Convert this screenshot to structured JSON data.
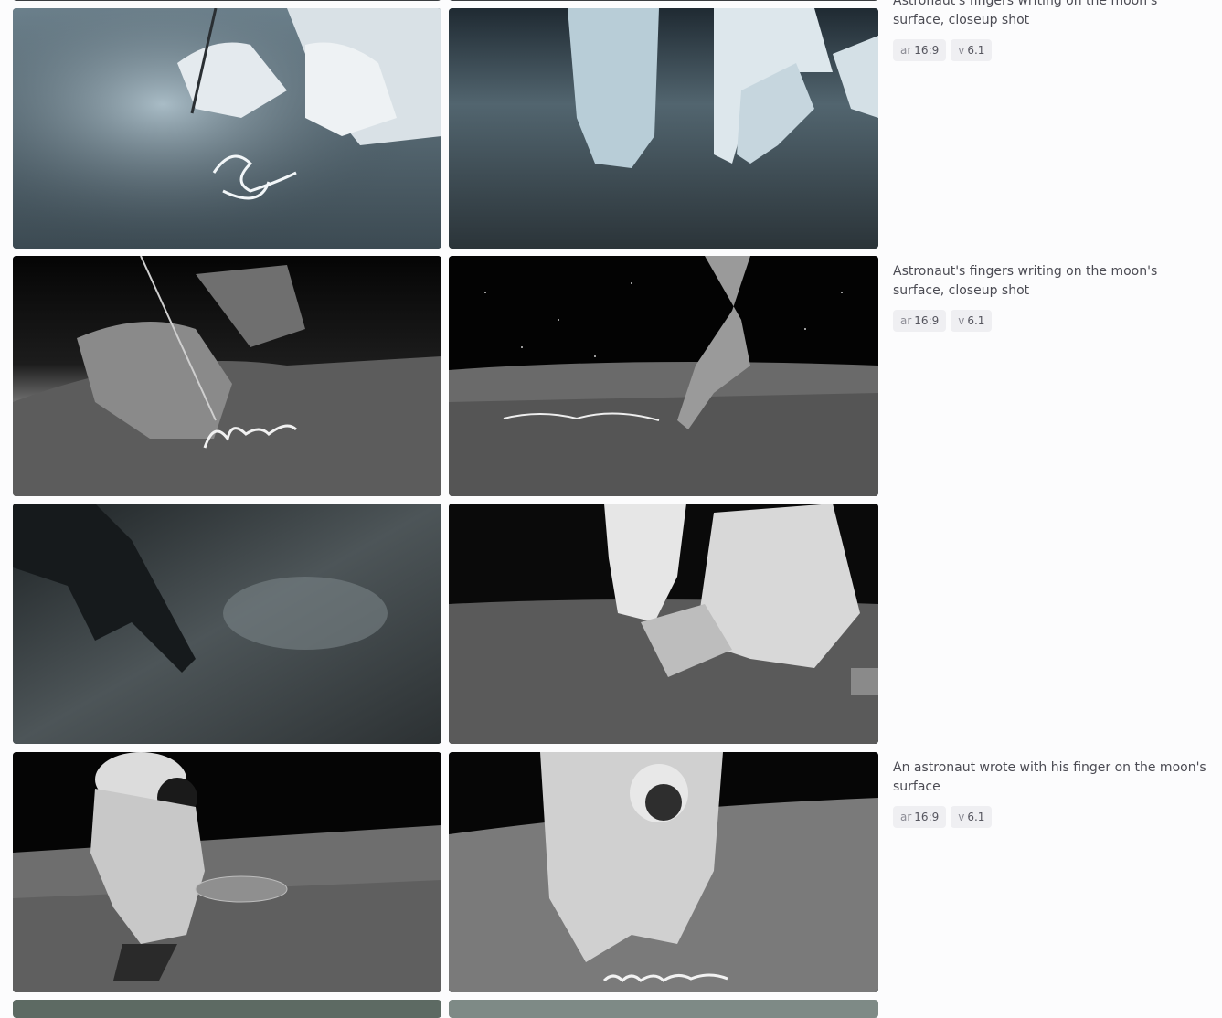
{
  "groups": [
    {
      "prompt": "Astronaut's fingers writing on the moon's surface, closeup shot",
      "params": [
        {
          "key": "ar",
          "value": "16:9"
        },
        {
          "key": "v",
          "value": "6.1"
        }
      ],
      "images": [
        {
          "alt": "Gloved hand with stylus writing on lunar dust, bluish tone"
        },
        {
          "alt": "Two gloved hands touching lunar soil, bluish tone"
        }
      ]
    },
    {
      "prompt": "Astronaut's fingers writing on the moon's surface, closeup shot",
      "params": [
        {
          "key": "ar",
          "value": "16:9"
        },
        {
          "key": "v",
          "value": "6.1"
        }
      ],
      "images": [
        {
          "alt": "Gloved hand with stylus writing script in lunar dust"
        },
        {
          "alt": "Gloved finger tracing writing on lunar surface under starry sky"
        }
      ]
    },
    {
      "prompt": "",
      "params": [],
      "images": [
        {
          "alt": "Dark gloved finger pointing at lunar soil"
        },
        {
          "alt": "Kneeling astronaut pressing hand into lunar soil"
        }
      ]
    },
    {
      "prompt": "An astronaut wrote with his finger on the moon's surface",
      "params": [
        {
          "key": "ar",
          "value": "16:9"
        },
        {
          "key": "v",
          "value": "6.1"
        }
      ],
      "images": [
        {
          "alt": "Astronaut standing over tracks on lunar surface"
        },
        {
          "alt": "Astronaut kneeling and writing on lunar surface"
        }
      ]
    }
  ],
  "colors": {
    "background": "#fcfcfd",
    "chip": "#efeff2",
    "text": "#4b4b53"
  }
}
